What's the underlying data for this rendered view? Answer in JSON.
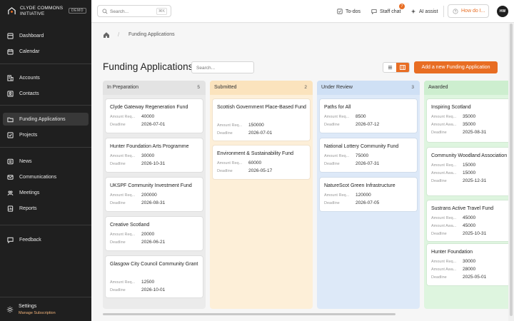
{
  "brand": {
    "line1": "CLYDE COMMONS",
    "line2": "INITIATIVE",
    "badge": "DEMO"
  },
  "sidebar": {
    "items": [
      {
        "label": "Dashboard",
        "icon": "dashboard-icon"
      },
      {
        "label": "Calendar",
        "icon": "calendar-icon"
      },
      {
        "label": "Accounts",
        "icon": "building-icon"
      },
      {
        "label": "Contacts",
        "icon": "contacts-icon"
      },
      {
        "label": "Funding Applications",
        "icon": "folder-icon",
        "active": true
      },
      {
        "label": "Projects",
        "icon": "projects-icon"
      },
      {
        "label": "News",
        "icon": "news-icon"
      },
      {
        "label": "Communications",
        "icon": "communications-icon"
      },
      {
        "label": "Meetings",
        "icon": "meetings-icon"
      },
      {
        "label": "Reports",
        "icon": "reports-icon"
      },
      {
        "label": "Feedback",
        "icon": "feedback-icon"
      }
    ],
    "settings": {
      "label": "Settings",
      "sublabel": "Manage Subscription"
    }
  },
  "topbar": {
    "search_placeholder": "Search...",
    "search_shortcut": "⌘K",
    "todos_label": "To-dos",
    "staff_chat_label": "Staff chat",
    "staff_chat_badge": "7",
    "ai_assist_label": "AI assist",
    "help_label": "How do I...",
    "avatar_initials": "HW"
  },
  "breadcrumb": {
    "current": "Funding Applications"
  },
  "page": {
    "title": "Funding Applications",
    "board_search_placeholder": "Search...",
    "add_button": "Add a new Funding Application"
  },
  "colors": {
    "accent": "#e86d23",
    "sidebar": "#1f1f1f"
  },
  "columns": [
    {
      "title": "In Preparation",
      "count": "5",
      "head_bg": "#e3e3e3",
      "body_bg": "#ebebeb",
      "cards": [
        {
          "title": "Clyde Gateway Regeneration Fund",
          "fields": [
            {
              "label": "Amount Req...",
              "value": "40000"
            },
            {
              "label": "Deadline",
              "value": "2026-07-01"
            }
          ]
        },
        {
          "title": "Hunter Foundation Arts Programme",
          "fields": [
            {
              "label": "Amount Req...",
              "value": "30000"
            },
            {
              "label": "Deadline",
              "value": "2026-10-31"
            }
          ]
        },
        {
          "title": "UKSPF Community Investment Fund",
          "fields": [
            {
              "label": "Amount Req...",
              "value": "200000"
            },
            {
              "label": "Deadline",
              "value": "2026-08-31"
            }
          ]
        },
        {
          "title": "Creative Scotland",
          "fields": [
            {
              "label": "Amount Req...",
              "value": "20000"
            },
            {
              "label": "Deadline",
              "value": "2026-06-21"
            }
          ]
        },
        {
          "title": "Glasgow City Council Community Grant",
          "fields": [
            {
              "label": "Amount Req...",
              "value": "12500"
            },
            {
              "label": "Deadline",
              "value": "2026-10-01"
            }
          ]
        }
      ]
    },
    {
      "title": "Submitted",
      "count": "2",
      "head_bg": "#fbe3bd",
      "body_bg": "#fdefd8",
      "cards": [
        {
          "title": "Scottish Government Place-Based Fund",
          "fields": [
            {
              "label": "Amount Req...",
              "value": "150000"
            },
            {
              "label": "Deadline",
              "value": "2026-07-01"
            }
          ]
        },
        {
          "title": "Environment & Sustainability Fund",
          "fields": [
            {
              "label": "Amount Req...",
              "value": "60000"
            },
            {
              "label": "Deadline",
              "value": "2026-05-17"
            }
          ]
        }
      ]
    },
    {
      "title": "Under Review",
      "count": "3",
      "head_bg": "#cfe0f5",
      "body_bg": "#dde9f8",
      "cards": [
        {
          "title": "Paths for All",
          "fields": [
            {
              "label": "Amount Req...",
              "value": "8500"
            },
            {
              "label": "Deadline",
              "value": "2026-07-12"
            }
          ]
        },
        {
          "title": "National Lottery Community Fund",
          "fields": [
            {
              "label": "Amount Req...",
              "value": "75000"
            },
            {
              "label": "Deadline",
              "value": "2026-07-31"
            }
          ]
        },
        {
          "title": "NatureScot Green Infrastructure",
          "fields": [
            {
              "label": "Amount Req...",
              "value": "120000"
            },
            {
              "label": "Deadline",
              "value": "2026-07-05"
            }
          ]
        }
      ]
    },
    {
      "title": "Awarded",
      "count": "",
      "head_bg": "#cdeecf",
      "body_bg": "#def5df",
      "cards": [
        {
          "title": "Inspiring Scotland",
          "fields": [
            {
              "label": "Amount Req...",
              "value": "35000"
            },
            {
              "label": "Amount Awa...",
              "value": "35000"
            },
            {
              "label": "Deadline",
              "value": "2025-08-31"
            }
          ]
        },
        {
          "title": "Community Woodland Association",
          "fields": [
            {
              "label": "Amount Req...",
              "value": "15000"
            },
            {
              "label": "Amount Awa...",
              "value": "15000"
            },
            {
              "label": "Deadline",
              "value": "2025-12-31"
            }
          ]
        },
        {
          "title": "Sustrans Active Travel Fund",
          "fields": [
            {
              "label": "Amount Req...",
              "value": "45000"
            },
            {
              "label": "Amount Awa...",
              "value": "45000"
            },
            {
              "label": "Deadline",
              "value": "2025-10-31"
            }
          ]
        },
        {
          "title": "Hunter Foundation",
          "fields": [
            {
              "label": "Amount Req...",
              "value": "30000"
            },
            {
              "label": "Amount Awa...",
              "value": "28000"
            },
            {
              "label": "Deadline",
              "value": "2025-05-01"
            }
          ]
        }
      ]
    }
  ]
}
